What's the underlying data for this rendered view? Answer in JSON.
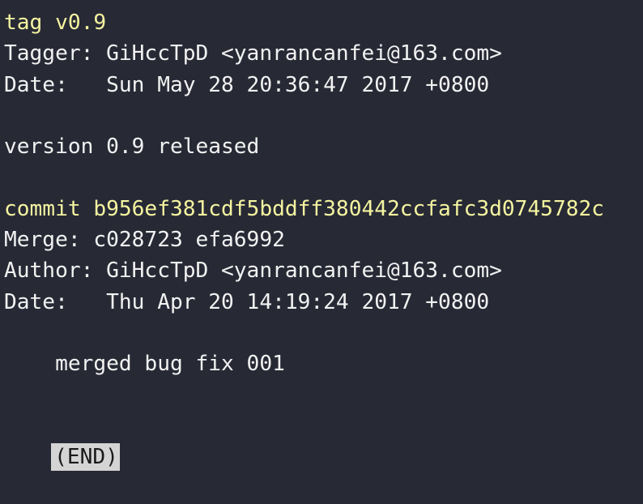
{
  "terminal": {
    "lines": [
      {
        "text": "tag v0.9",
        "style": "yellow"
      },
      {
        "text": "Tagger: GiHccTpD <yanrancanfei@163.com>",
        "style": "normal"
      },
      {
        "text": "Date:   Sun May 28 20:36:47 2017 +0800",
        "style": "normal"
      },
      {
        "text": "",
        "style": "normal"
      },
      {
        "text": "version 0.9 released",
        "style": "normal"
      },
      {
        "text": "",
        "style": "normal"
      },
      {
        "text": "commit b956ef381cdf5bddff380442ccfafc3d0745782c",
        "style": "yellow"
      },
      {
        "text": "Merge: c028723 efa6992",
        "style": "normal"
      },
      {
        "text": "Author: GiHccTpD <yanrancanfei@163.com>",
        "style": "normal"
      },
      {
        "text": "Date:   Thu Apr 20 14:19:24 2017 +0800",
        "style": "normal"
      },
      {
        "text": "",
        "style": "normal"
      },
      {
        "text": "    merged bug fix 001",
        "style": "normal"
      },
      {
        "text": "",
        "style": "normal"
      }
    ],
    "end_marker": "(END)"
  },
  "colors": {
    "background": "#272935",
    "text": "#f2f2f2",
    "highlight": "#f4f4a0",
    "pager_prompt_bg": "#d4d4d4"
  }
}
